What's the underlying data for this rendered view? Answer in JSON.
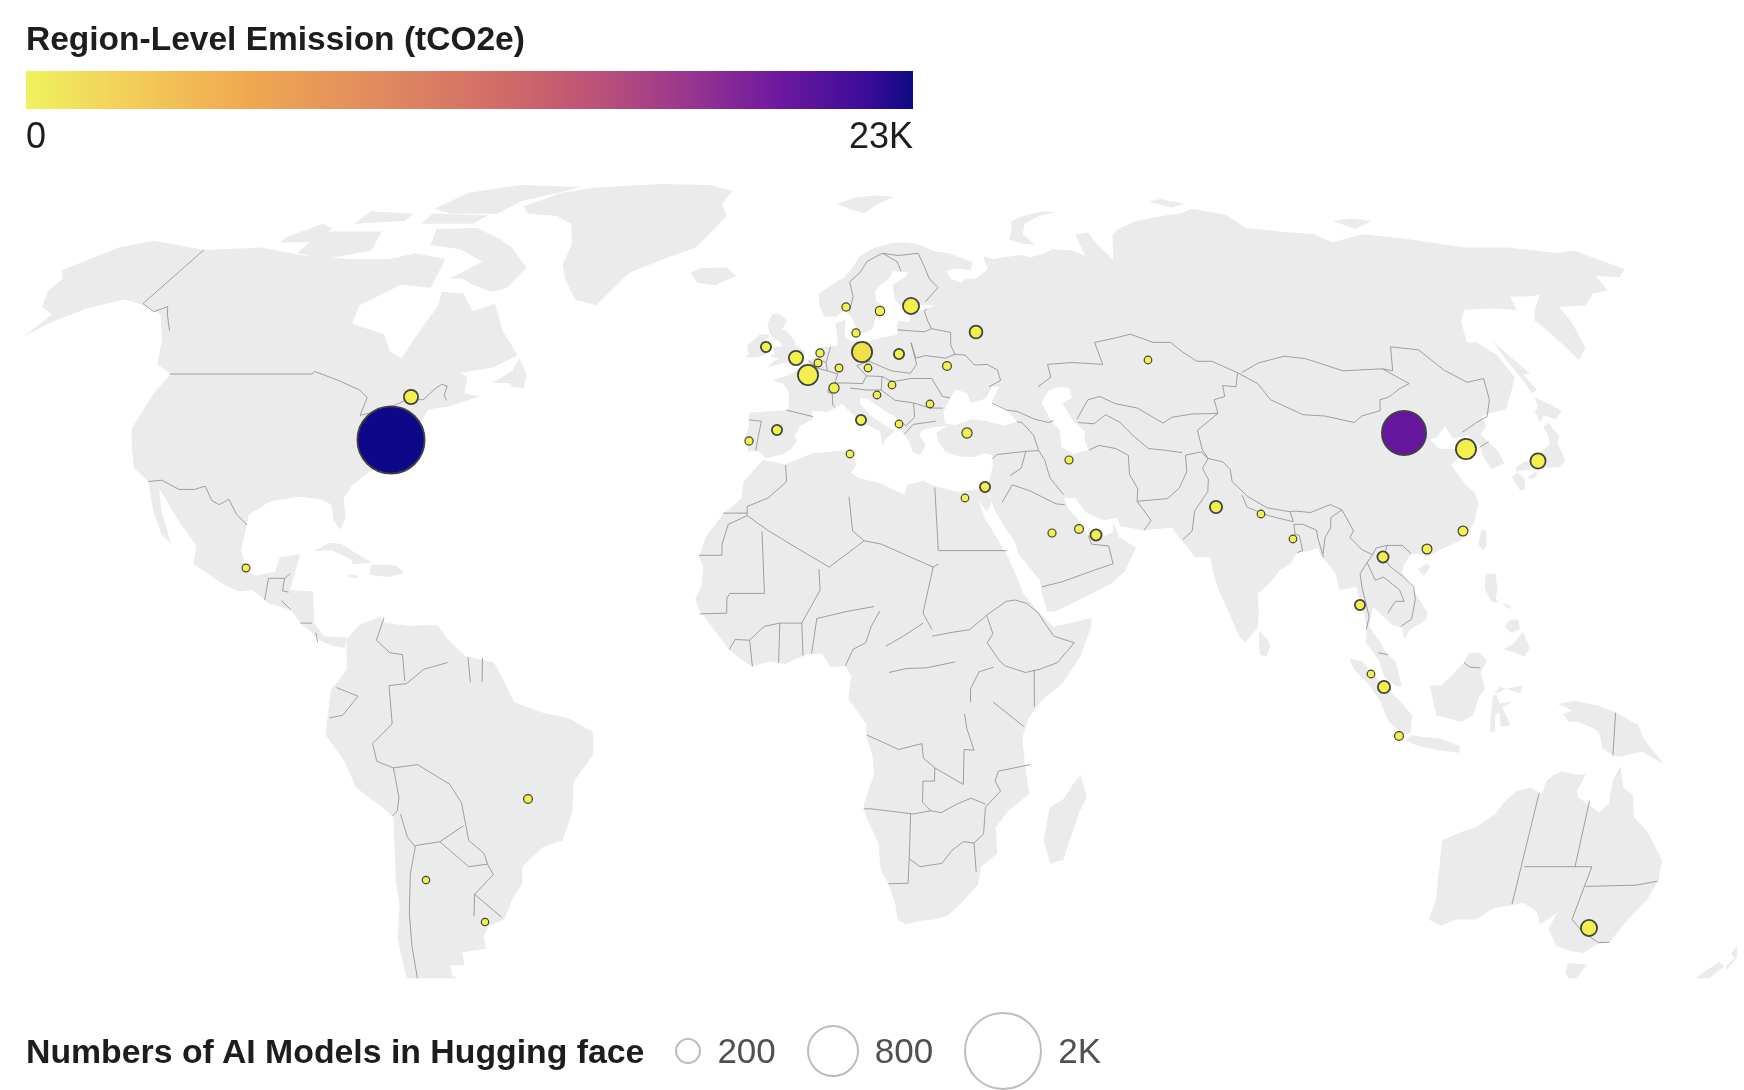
{
  "color_legend": {
    "title": "Region-Level Emission (tCO2e)",
    "min_label": "0",
    "max_label": "23K"
  },
  "map": {
    "bubbles": [
      {
        "color": "#0d0887"
      },
      {
        "color": "#f2f04a"
      },
      {
        "color": "#f2f04a"
      },
      {
        "color": "#f2f04a"
      },
      {
        "color": "#f2f04a"
      },
      {
        "color": "#f2f04a"
      },
      {
        "color": "#f2f04a"
      },
      {
        "color": "#f2f04a"
      },
      {
        "color": "#f2f04a"
      },
      {
        "color": "#f2f04a"
      },
      {
        "color": "#f2f04a"
      },
      {
        "color": "#f2f04a"
      },
      {
        "color": "#f2f04a"
      },
      {
        "color": "#f2f04a"
      },
      {
        "color": "#f2f04a"
      },
      {
        "color": "#f2f04a"
      },
      {
        "color": "#f0e04a"
      },
      {
        "color": "#f2f04a"
      },
      {
        "color": "#f2f04a"
      },
      {
        "color": "#f2f04a"
      },
      {
        "color": "#f2f04a"
      },
      {
        "color": "#f2f04a"
      },
      {
        "color": "#f2f04a"
      },
      {
        "color": "#f2f04a"
      },
      {
        "color": "#f2f04a"
      },
      {
        "color": "#f2f04a"
      },
      {
        "color": "#f2f04a"
      },
      {
        "color": "#f2f04a"
      },
      {
        "color": "#f2f04a"
      },
      {
        "color": "#f2f04a"
      },
      {
        "color": "#f2f04a"
      },
      {
        "color": "#f2f04a"
      },
      {
        "color": "#f2f04a"
      },
      {
        "color": "#f2f04a"
      },
      {
        "color": "#f2f04a"
      },
      {
        "color": "#f2f04a"
      },
      {
        "color": "#f2f04a"
      },
      {
        "color": "#f2f04a"
      },
      {
        "color": "#f2f04a"
      },
      {
        "color": "#f2f04a"
      },
      {
        "color": "#f2f04a"
      },
      {
        "color": "#66169c"
      },
      {
        "color": "#f2f04a"
      },
      {
        "color": "#f2f04a"
      },
      {
        "color": "#f2f04a"
      },
      {
        "color": "#f2f04a"
      },
      {
        "color": "#f2f04a"
      },
      {
        "color": "#f2f04a"
      },
      {
        "color": "#f2f04a"
      },
      {
        "color": "#f2f04a"
      },
      {
        "color": "#f2f04a"
      },
      {
        "color": "#f2f04a"
      }
    ]
  },
  "size_legend": {
    "title": "Numbers of AI Models in Hugging face",
    "items": [
      {
        "label": "200"
      },
      {
        "label": "800"
      },
      {
        "label": "2K"
      }
    ]
  }
}
